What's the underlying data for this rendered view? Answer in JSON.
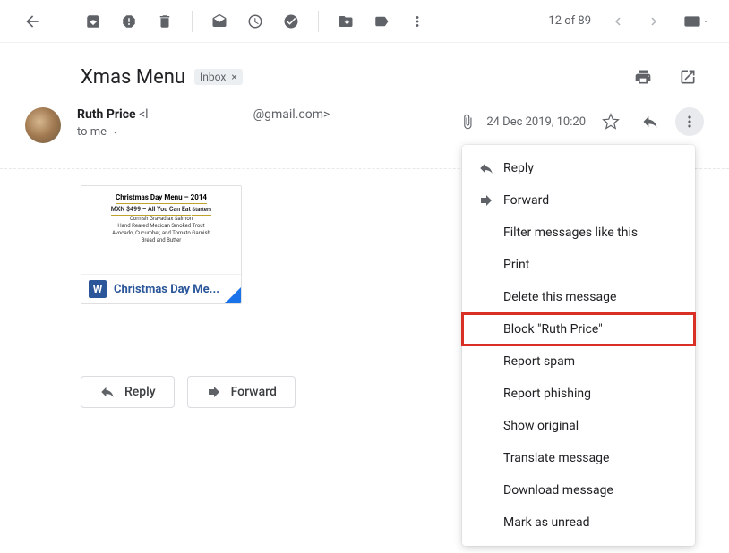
{
  "toolbar": {
    "counter": "12 of 89"
  },
  "subject": "Xmas Menu",
  "label": {
    "name": "Inbox"
  },
  "sender": {
    "name": "Ruth Price",
    "email_prefix": "<l",
    "email_suffix": "@gmail.com>",
    "to": "to me"
  },
  "meta": {
    "date": "24 Dec 2019, 10:20"
  },
  "attachment": {
    "filename": "Christmas Day Me...",
    "preview": {
      "title": "Christmas Day Menu – 2014",
      "price": "MXN $499 – All You Can Eat",
      "section": "Starters",
      "line1": "Cornish Gravadlax Salmon",
      "line2": "Hand Reared Mexican Smoked Trout",
      "line3": "Avocado, Cucumber, and Tomato Garnish",
      "line4": "Bread and Butter"
    }
  },
  "buttons": {
    "reply": "Reply",
    "forward": "Forward"
  },
  "menu": {
    "items": [
      {
        "label": "Reply",
        "icon": "reply"
      },
      {
        "label": "Forward",
        "icon": "forward"
      },
      {
        "label": "Filter messages like this",
        "icon": ""
      },
      {
        "label": "Print",
        "icon": ""
      },
      {
        "label": "Delete this message",
        "icon": ""
      },
      {
        "label": "Block \"Ruth Price\"",
        "icon": "",
        "highlight": true
      },
      {
        "label": "Report spam",
        "icon": ""
      },
      {
        "label": "Report phishing",
        "icon": ""
      },
      {
        "label": "Show original",
        "icon": ""
      },
      {
        "label": "Translate message",
        "icon": ""
      },
      {
        "label": "Download message",
        "icon": ""
      },
      {
        "label": "Mark as unread",
        "icon": ""
      }
    ]
  }
}
